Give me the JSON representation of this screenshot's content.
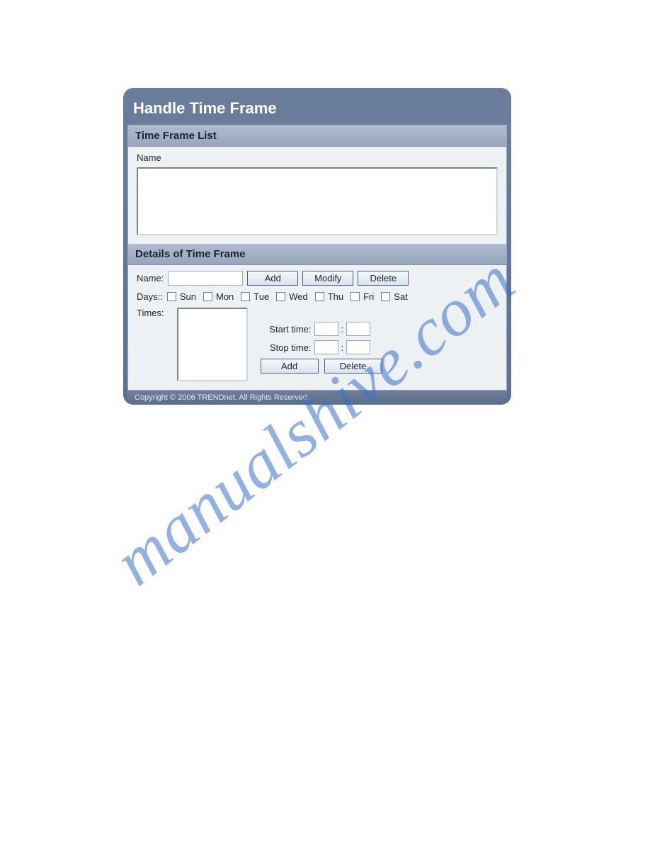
{
  "panel": {
    "title": "Handle Time Frame"
  },
  "list_section": {
    "header": "Time Frame List",
    "name_label": "Name"
  },
  "details_section": {
    "header": "Details of Time Frame",
    "name_label": "Name:",
    "name_value": "",
    "add_button": "Add",
    "modify_button": "Modify",
    "delete_button": "Delete",
    "days_label": "Days::",
    "days": [
      "Sun",
      "Mon",
      "Tue",
      "Wed",
      "Thu",
      "Fri",
      "Sat"
    ],
    "times_label": "Times:",
    "start_label": "Start time:",
    "stop_label": "Stop time:",
    "start_h": "",
    "start_m": "",
    "stop_h": "",
    "stop_m": "",
    "time_colon": ":",
    "time_add_button": "Add",
    "time_delete_button": "Delete"
  },
  "footer": {
    "copyright": "Copyright © 2006 TRENDnet. All Rights Reserved."
  },
  "watermark": "manualshive.com"
}
